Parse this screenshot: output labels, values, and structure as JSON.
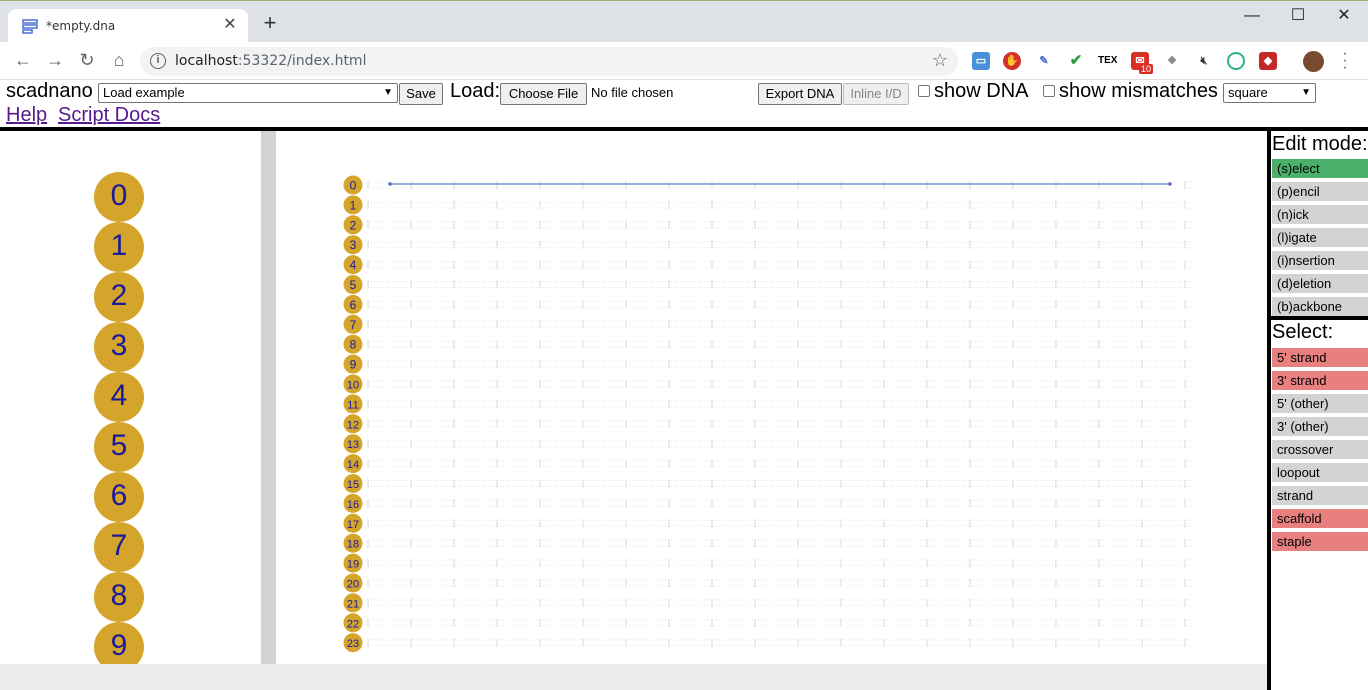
{
  "browser": {
    "tab_title": "*empty.dna",
    "url_host": "localhost",
    "url_rest": ":53322/index.html",
    "extension_badge": "10",
    "tex_label": "TEX"
  },
  "header": {
    "brand": "scadnano",
    "load_example_value": "Load example",
    "save_label": "Save",
    "load_label": "Load:",
    "choose_file_label": "Choose File",
    "no_file_label": "No file chosen",
    "export_label": "Export DNA",
    "inline_label": "Inline I/D",
    "show_dna_label": "show DNA",
    "show_mismatches_label": "show mismatches",
    "shape_value": "square",
    "help_link": "Help",
    "script_docs_link": "Script Docs"
  },
  "side_view": {
    "helices": [
      "0",
      "1",
      "2",
      "3",
      "4",
      "5",
      "6",
      "7",
      "8",
      "9"
    ]
  },
  "main_view": {
    "helix_labels": [
      "0",
      "1",
      "2",
      "3",
      "4",
      "5",
      "6",
      "7",
      "8",
      "9",
      "10",
      "11",
      "12",
      "13",
      "14",
      "15",
      "16",
      "17",
      "18",
      "19",
      "20",
      "21",
      "22",
      "23"
    ],
    "strand_on_helix": "0",
    "colors": {
      "helix_circle": "#d4a52a",
      "helix_text": "#1a1a9a",
      "strand": "#7b8fd6"
    }
  },
  "edit_mode": {
    "title": "Edit mode:",
    "modes": [
      {
        "label": "(s)elect",
        "active": true
      },
      {
        "label": "(p)encil",
        "active": false
      },
      {
        "label": "(n)ick",
        "active": false
      },
      {
        "label": "(l)igate",
        "active": false
      },
      {
        "label": "(i)nsertion",
        "active": false
      },
      {
        "label": "(d)eletion",
        "active": false
      },
      {
        "label": "(b)ackbone",
        "active": false
      }
    ]
  },
  "select_mode": {
    "title": "Select:",
    "options": [
      {
        "label": "5' strand",
        "on": true
      },
      {
        "label": "3' strand",
        "on": true
      },
      {
        "label": "5' (other)",
        "on": false
      },
      {
        "label": "3' (other)",
        "on": false
      },
      {
        "label": "crossover",
        "on": false
      },
      {
        "label": "loopout",
        "on": false
      },
      {
        "label": "strand",
        "on": false
      },
      {
        "label": "scaffold",
        "on": true
      },
      {
        "label": "staple",
        "on": true
      }
    ]
  }
}
